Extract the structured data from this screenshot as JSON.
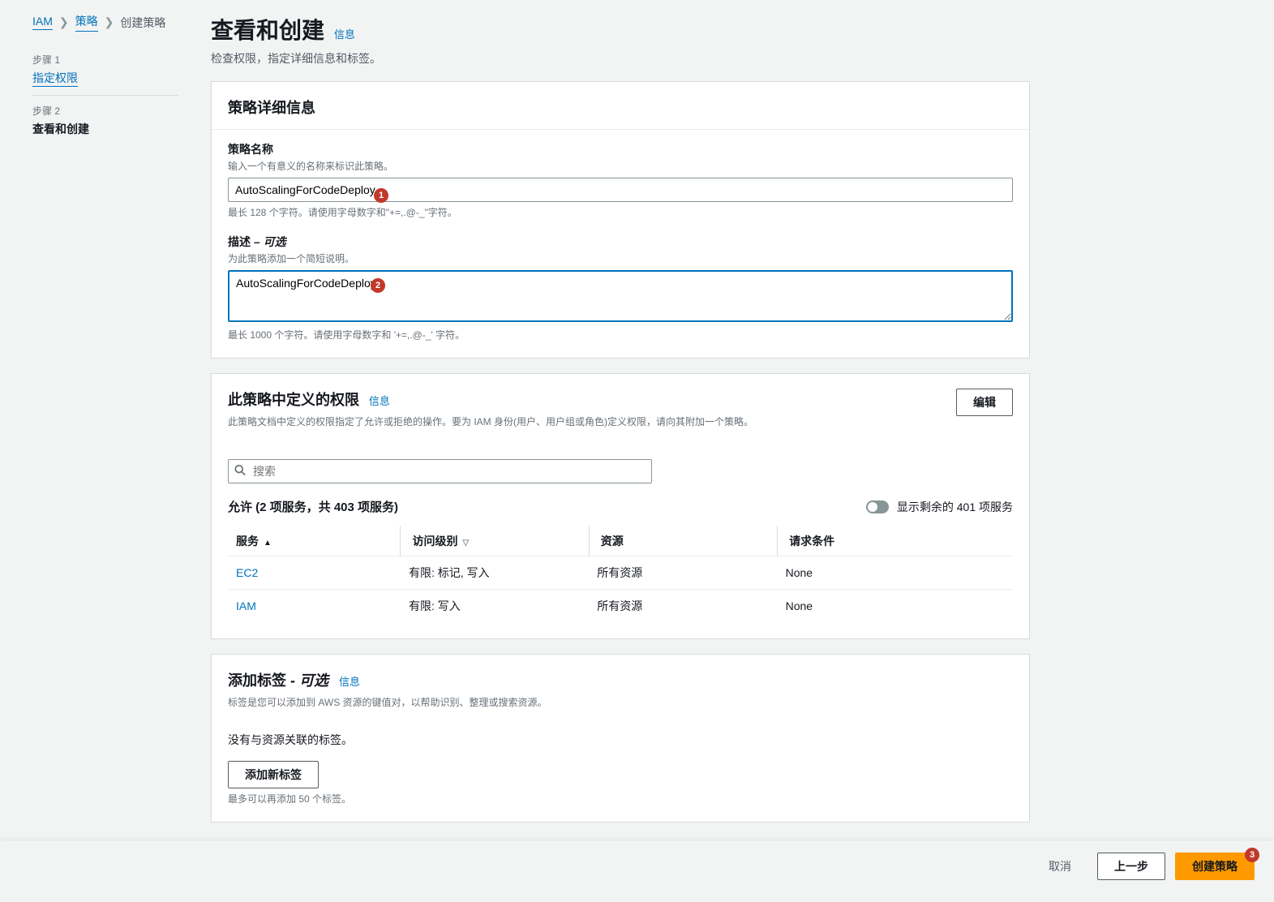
{
  "breadcrumb": {
    "iam": "IAM",
    "policies": "策略",
    "create": "创建策略"
  },
  "steps": {
    "s1_num": "步骤 1",
    "s1_label": "指定权限",
    "s2_num": "步骤 2",
    "s2_label": "查看和创建"
  },
  "header": {
    "title": "查看和创建",
    "info": "信息",
    "subtitle": "检查权限，指定详细信息和标签。"
  },
  "details": {
    "panel_title": "策略详细信息",
    "name_label": "策略名称",
    "name_desc": "输入一个有意义的名称来标识此策略。",
    "name_value": "AutoScalingForCodeDeploy",
    "name_help": "最长 128 个字符。请使用字母数字和\"+=,.@-_\"字符。",
    "desc_label": "描述 –",
    "desc_optional": "可选",
    "desc_desc": "为此策略添加一个简短说明。",
    "desc_value": "AutoScalingForCodeDeploy",
    "desc_help": "最长 1000 个字符。请使用字母数字和 '+=,.@-_' 字符。"
  },
  "perms": {
    "panel_title": "此策略中定义的权限",
    "info": "信息",
    "edit": "编辑",
    "desc": "此策略文档中定义的权限指定了允许或拒绝的操作。要为 IAM 身份(用户、用户组或角色)定义权限，请向其附加一个策略。",
    "search_placeholder": "搜索",
    "allow_text": "允许 (2 项服务，共 403 项服务)",
    "toggle_label": "显示剩余的 401 项服务",
    "cols": {
      "service": "服务",
      "access": "访问级别",
      "resource": "资源",
      "cond": "请求条件"
    },
    "rows": [
      {
        "service": "EC2",
        "access": "有限: 标记, 写入",
        "resource": "所有资源",
        "cond": "None"
      },
      {
        "service": "IAM",
        "access": "有限: 写入",
        "resource": "所有资源",
        "cond": "None"
      }
    ]
  },
  "tags": {
    "panel_title_pre": "添加标签 -",
    "panel_title_opt": "可选",
    "info": "信息",
    "desc": "标签是您可以添加到 AWS 资源的键值对，以帮助识别、整理或搜索资源。",
    "none": "没有与资源关联的标签。",
    "add_btn": "添加新标签",
    "limit": "最多可以再添加 50 个标签。"
  },
  "footer": {
    "cancel": "取消",
    "prev": "上一步",
    "create": "创建策略"
  },
  "callouts": {
    "c1": "1",
    "c2": "2",
    "c3": "3"
  }
}
